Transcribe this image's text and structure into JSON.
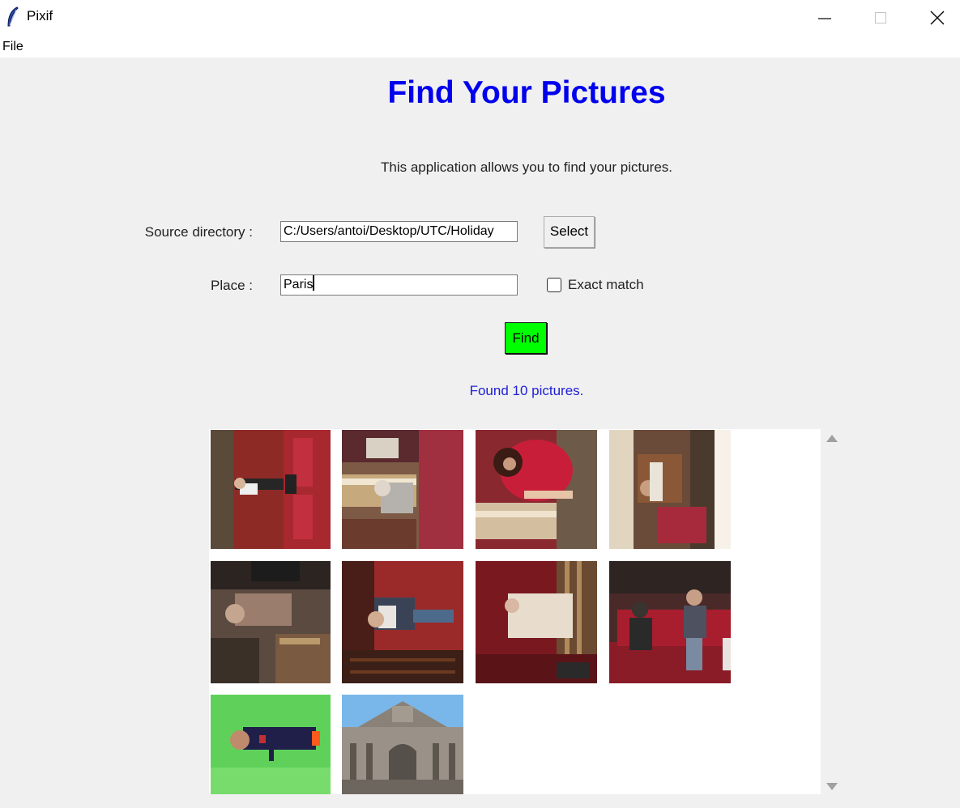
{
  "window": {
    "title": "Pixif",
    "controls": {
      "minimize_icon": "minimize-icon",
      "maximize_icon": "maximize-icon",
      "close_icon": "close-icon"
    }
  },
  "menu": {
    "file_label": "File"
  },
  "main": {
    "heading": "Find Your Pictures",
    "subtitle": "This application allows you to find your pictures.",
    "heading_color": "#0000ee",
    "source": {
      "label": "Source directory :",
      "value": "C:/Users/antoi/Desktop/UTC/Holiday"
    },
    "select_label": "Select",
    "place": {
      "label": "Place :",
      "value": "Paris"
    },
    "exact_match": {
      "label": "Exact match",
      "checked": false
    },
    "find_label": "Find",
    "find_color": "#00ff00",
    "status": "Found 10 pictures.",
    "status_color": "#2020d8"
  },
  "gallery": {
    "count": 10,
    "thumbnails": [
      {
        "name": "photo-1",
        "description": "rotated photo of a man in a suit in a red theatre"
      },
      {
        "name": "photo-2",
        "description": "rotated photo of a man at an ornate gilded balcony"
      },
      {
        "name": "photo-3",
        "description": "rotated photo of a woman in a red dress"
      },
      {
        "name": "photo-4",
        "description": "rotated photo of a costumed figure near red seats"
      },
      {
        "name": "photo-5",
        "description": "rotated photo of people on a balcony"
      },
      {
        "name": "photo-6",
        "description": "rotated photo of a man on a staircase"
      },
      {
        "name": "photo-7",
        "description": "rotated photo of a woman in a white dress"
      },
      {
        "name": "photo-8",
        "description": "two men seated on a red bench"
      },
      {
        "name": "photo-9",
        "description": "rotated photo of a man in sportswear on green screen"
      },
      {
        "name": "photo-10",
        "description": "palace facade under blue sky"
      }
    ]
  }
}
